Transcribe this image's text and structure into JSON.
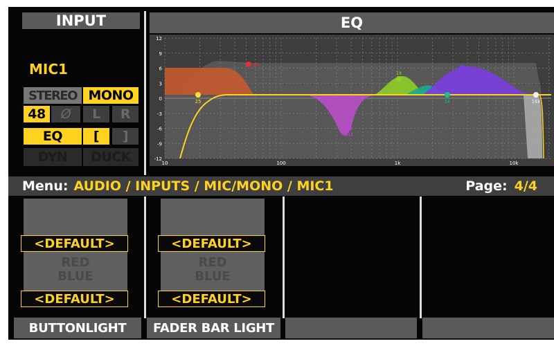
{
  "input_header": "INPUT",
  "eq_header": "EQ",
  "channel_name": "MIC1",
  "buttons": {
    "stereo": "STEREO",
    "mono": "MONO",
    "phantom": "48",
    "phase": "Ø",
    "left": "L",
    "right": "R",
    "eq": "EQ",
    "bracket_open": "[",
    "bracket_close": "]",
    "dyn": "DYN",
    "duck": "DUCK"
  },
  "eq_graph": {
    "y_ticks": [
      "12",
      "9",
      "6",
      "3",
      "0",
      "-3",
      "-6",
      "-9",
      "-12"
    ],
    "x_ticks": [
      "10",
      "100",
      "1k",
      "10k"
    ],
    "bands": [
      {
        "label": "25",
        "color": "#ffe033"
      },
      {
        "label": "80",
        "color": "#e53030"
      },
      {
        "label": "345",
        "color": "#c040d8"
      },
      {
        "label": "1k",
        "color": "#8fd12a"
      },
      {
        "label": "5k",
        "color": "#1fbf8f"
      },
      {
        "label": "",
        "color": "#7a3fe0"
      },
      {
        "label": "16k",
        "color": "#f2f2f2"
      }
    ]
  },
  "menu": {
    "label": "Menu:",
    "path": "AUDIO / INPUTS / MIC/MONO / MIC1",
    "page_label": "Page:",
    "page_value": "4/4"
  },
  "slots": [
    {
      "top_value": "<DEFAULT>",
      "ghost1": "RED",
      "ghost2": "BLUE",
      "bottom_value": "<DEFAULT>",
      "label": "BUTTONLIGHT"
    },
    {
      "top_value": "<DEFAULT>",
      "ghost1": "RED",
      "ghost2": "BLUE",
      "bottom_value": "<DEFAULT>",
      "label": "FADER BAR LIGHT"
    }
  ],
  "colors": {
    "accent": "#ffd21f",
    "header_bg": "#5a5a5a",
    "background": "#050505"
  }
}
